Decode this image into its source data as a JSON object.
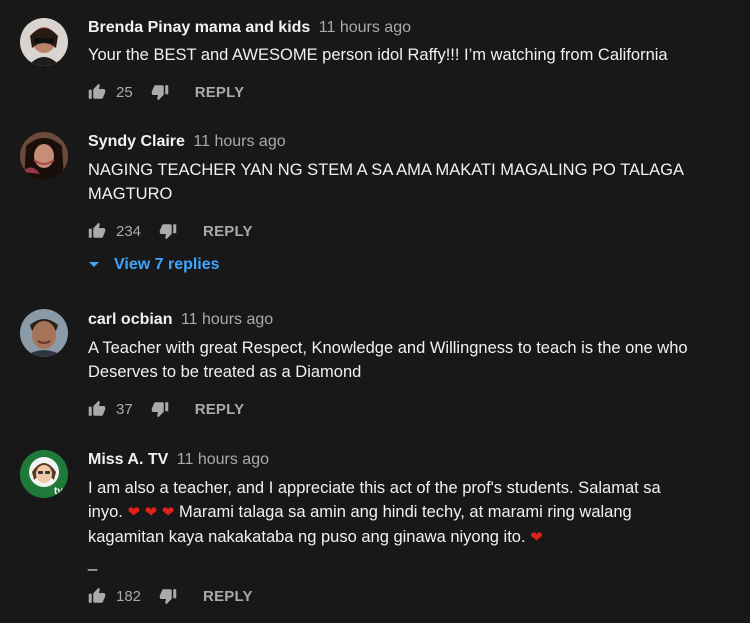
{
  "colors": {
    "background": "#181818",
    "primary_text": "#f1f1f1",
    "secondary_text": "#aaaaaa",
    "link_blue": "#3ea6ff",
    "heart_red": "#e0211c"
  },
  "reply_label": "REPLY",
  "comments": [
    {
      "author": "Brenda Pinay mama and kids",
      "time": "11 hours ago",
      "text": "Your the BEST and AWESOME person idol Raffy!!! I’m watching from California",
      "likes": "25"
    },
    {
      "author": "Syndy Claire",
      "time": "11 hours ago",
      "text": "NAGING TEACHER YAN NG STEM A SA AMA MAKATI MAGALING PO TALAGA MAGTURO",
      "likes": "234",
      "view_replies": "View 7 replies"
    },
    {
      "author": "carl ocbian",
      "time": "11 hours ago",
      "text": "A Teacher with great Respect, Knowledge and Willingness to teach is the one who Deserves to be treated as a Diamond",
      "likes": "37"
    },
    {
      "author": "Miss A. TV",
      "time": "11 hours ago",
      "text_part1": "I am also a teacher, and I appreciate this act of the prof's students. Salamat sa inyo.",
      "text_part2": "Marami talaga sa amin ang hindi techy, at marami ring walang kagamitan kaya nakakataba ng puso ang ginawa niyong ito.",
      "text_trailing": "_",
      "heart": "❤",
      "likes": "182"
    }
  ],
  "icons": {
    "like": "thumb-up-icon",
    "dislike": "thumb-down-icon",
    "expand": "chevron-down-icon"
  }
}
